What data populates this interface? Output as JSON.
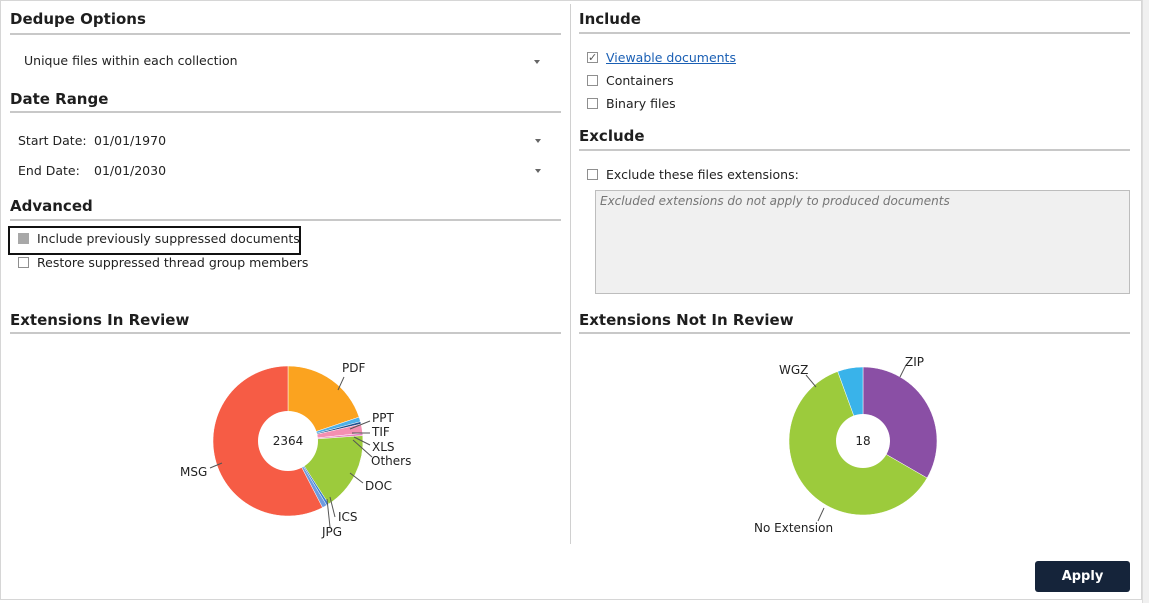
{
  "dedupe": {
    "title": "Dedupe Options",
    "selected": "Unique files within each collection"
  },
  "date_range": {
    "title": "Date Range",
    "start_label": "Start Date:",
    "start_value": "01/01/1970",
    "end_label": "End Date:",
    "end_value": "01/01/2030"
  },
  "advanced": {
    "title": "Advanced",
    "opt1": "Include previously suppressed documents",
    "opt2": "Restore suppressed thread group members"
  },
  "include": {
    "title": "Include",
    "viewable": "Viewable documents",
    "viewable_checked": true,
    "containers": "Containers",
    "binary": "Binary files"
  },
  "exclude": {
    "title": "Exclude",
    "checkbox_label": "Exclude these files extensions:",
    "placeholder": "Excluded extensions do not apply to produced documents"
  },
  "ext_in_review": {
    "title": "Extensions In Review",
    "center": "2364",
    "labels": {
      "pdf": "PDF",
      "ppt": "PPT",
      "tif": "TIF",
      "xls": "XLS",
      "others": "Others",
      "doc": "DOC",
      "ics": "ICS",
      "jpg": "JPG",
      "msg": "MSG"
    }
  },
  "ext_not_in_review": {
    "title": "Extensions Not In Review",
    "center": "18",
    "labels": {
      "zip": "ZIP",
      "wgz": "WGZ",
      "noext": "No Extension"
    }
  },
  "chart_data": [
    {
      "type": "pie",
      "title": "Extensions In Review",
      "total": 2364,
      "categories": [
        "PDF",
        "PPT",
        "TIF",
        "XLS",
        "Others",
        "DOC",
        "ICS",
        "JPG",
        "MSG"
      ],
      "values": [
        469,
        24,
        12,
        47,
        12,
        402,
        12,
        24,
        1362
      ],
      "colors": [
        "#fba31f",
        "#4fb0e8",
        "#1f4e8c",
        "#f48fb1",
        "#e882c1",
        "#9ccb3c",
        "#3a7fd1",
        "#6e9be0",
        "#f65c45"
      ]
    },
    {
      "type": "pie",
      "title": "Extensions Not In Review",
      "total": 18,
      "categories": [
        "ZIP",
        "No Extension",
        "WGZ"
      ],
      "values": [
        6,
        11,
        1
      ],
      "colors": [
        "#8a4fa5",
        "#9ccb3c",
        "#39b3ea"
      ]
    }
  ],
  "apply_label": "Apply"
}
